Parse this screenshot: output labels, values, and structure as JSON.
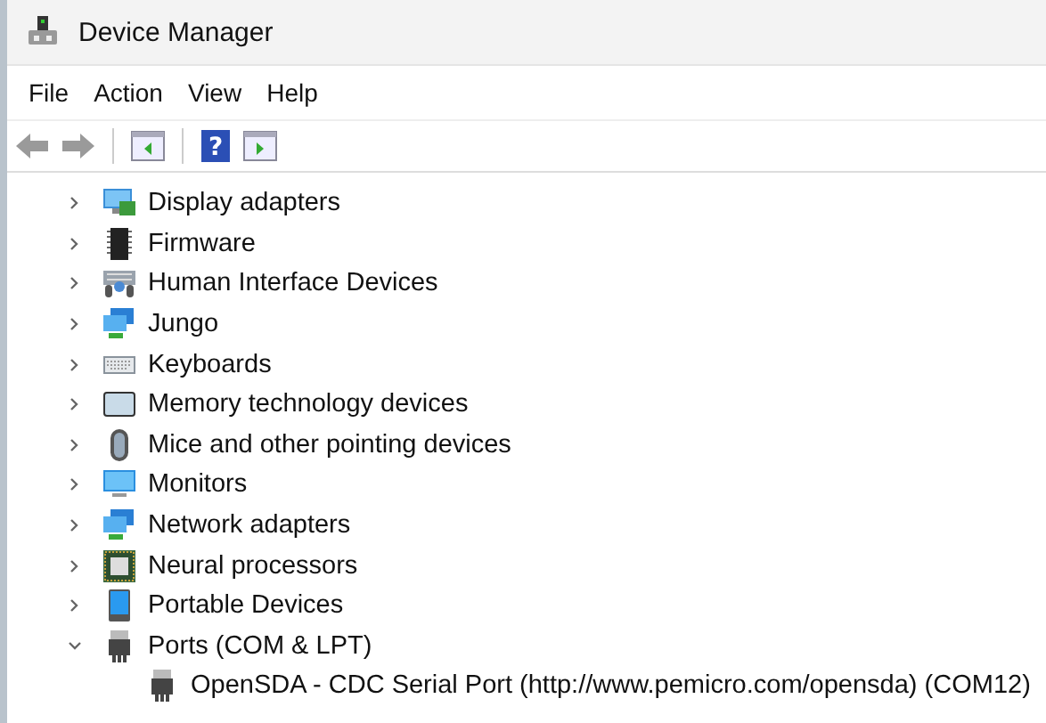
{
  "window": {
    "title": "Device Manager"
  },
  "menu": [
    "File",
    "Action",
    "View",
    "Help"
  ],
  "toolbar": {
    "help_glyph": "?"
  },
  "tree": [
    {
      "label": "Display adapters",
      "expanded": false
    },
    {
      "label": "Firmware",
      "expanded": false
    },
    {
      "label": "Human Interface Devices",
      "expanded": false
    },
    {
      "label": "Jungo",
      "expanded": false
    },
    {
      "label": "Keyboards",
      "expanded": false
    },
    {
      "label": "Memory technology devices",
      "expanded": false
    },
    {
      "label": "Mice and other pointing devices",
      "expanded": false
    },
    {
      "label": "Monitors",
      "expanded": false
    },
    {
      "label": "Network adapters",
      "expanded": false
    },
    {
      "label": "Neural processors",
      "expanded": false
    },
    {
      "label": "Portable Devices",
      "expanded": false
    },
    {
      "label": "Ports (COM & LPT)",
      "expanded": true,
      "children": [
        {
          "label": "OpenSDA - CDC Serial Port (http://www.pemicro.com/opensda) (COM12)"
        }
      ]
    }
  ]
}
